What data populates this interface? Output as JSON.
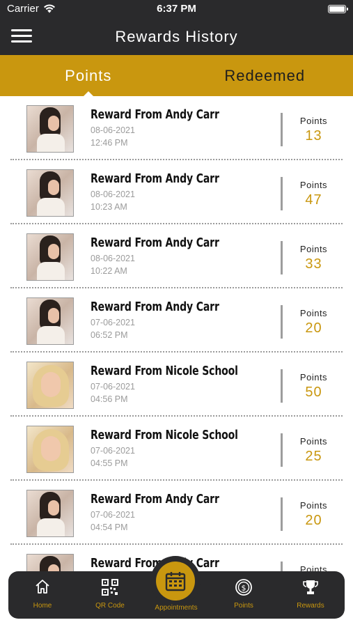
{
  "status_bar": {
    "carrier": "Carrier",
    "time": "6:37 PM"
  },
  "header": {
    "title": "Rewards History"
  },
  "tabs": [
    {
      "label": "Points",
      "active": true
    },
    {
      "label": "Redeemed",
      "active": false
    }
  ],
  "rewards": [
    {
      "name": "Reward From Andy Carr",
      "date": "08-06-2021",
      "time": "12:46 PM",
      "points_label": "Points",
      "points": "13",
      "avatar": "brunette"
    },
    {
      "name": "Reward From Andy Carr",
      "date": "08-06-2021",
      "time": "10:23 AM",
      "points_label": "Points",
      "points": "47",
      "avatar": "brunette"
    },
    {
      "name": "Reward From Andy Carr",
      "date": "08-06-2021",
      "time": "10:22 AM",
      "points_label": "Points",
      "points": "33",
      "avatar": "brunette"
    },
    {
      "name": "Reward From Andy Carr",
      "date": "07-06-2021",
      "time": "06:52 PM",
      "points_label": "Points",
      "points": "20",
      "avatar": "brunette"
    },
    {
      "name": "Reward From Nicole School",
      "date": "07-06-2021",
      "time": "04:56 PM",
      "points_label": "Points",
      "points": "50",
      "avatar": "blonde"
    },
    {
      "name": "Reward From Nicole School",
      "date": "07-06-2021",
      "time": "04:55 PM",
      "points_label": "Points",
      "points": "25",
      "avatar": "blonde"
    },
    {
      "name": "Reward From Andy Carr",
      "date": "07-06-2021",
      "time": "04:54 PM",
      "points_label": "Points",
      "points": "20",
      "avatar": "brunette"
    },
    {
      "name": "Reward From Andy Carr",
      "date": "",
      "time": "",
      "points_label": "Points",
      "points": "",
      "avatar": "brunette"
    }
  ],
  "bottom_nav": {
    "home": "Home",
    "qr": "QR Code",
    "appointments": "Appointments",
    "points": "Points",
    "rewards": "Rewards"
  },
  "colors": {
    "accent": "#c9970f",
    "dark": "#2a2a2c"
  }
}
